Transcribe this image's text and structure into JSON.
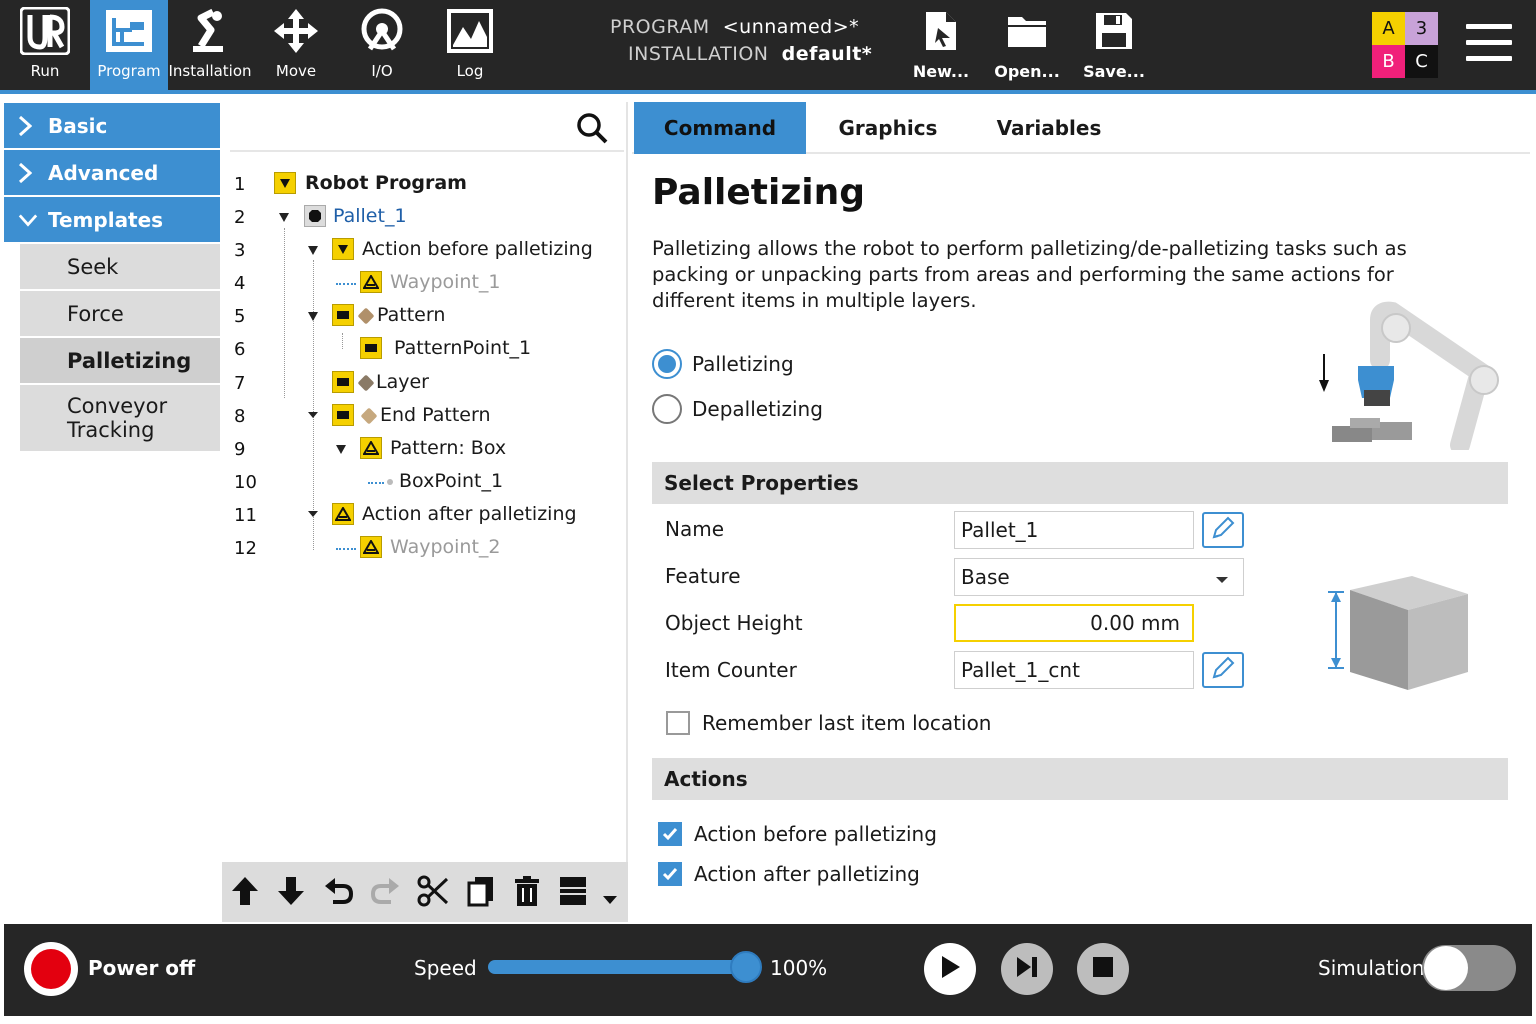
{
  "topbar": {
    "nav": [
      {
        "id": "run",
        "label": "Run",
        "icon": "ur-logo-icon"
      },
      {
        "id": "program",
        "label": "Program",
        "icon": "program-icon"
      },
      {
        "id": "installation",
        "label": "Installation",
        "icon": "installation-icon"
      },
      {
        "id": "move",
        "label": "Move",
        "icon": "move-icon"
      },
      {
        "id": "io",
        "label": "I/O",
        "icon": "io-icon"
      },
      {
        "id": "log",
        "label": "Log",
        "icon": "log-icon"
      }
    ],
    "program_label": "PROGRAM",
    "program_value": "<unnamed>*",
    "installation_label": "INSTALLATION",
    "installation_value": "default*",
    "file_buttons": [
      {
        "id": "new",
        "label": "New..."
      },
      {
        "id": "open",
        "label": "Open..."
      },
      {
        "id": "save",
        "label": "Save..."
      }
    ],
    "abc": {
      "a": "A",
      "three": "3",
      "b": "B",
      "c": "C"
    }
  },
  "sidebar": {
    "categories": [
      {
        "label": "Basic",
        "expanded": false
      },
      {
        "label": "Advanced",
        "expanded": false
      },
      {
        "label": "Templates",
        "expanded": true
      }
    ],
    "templates": [
      "Seek",
      "Force",
      "Palletizing",
      "Conveyor\nTracking"
    ],
    "active_template": "Palletizing"
  },
  "tree": {
    "rows": [
      {
        "num": "1",
        "label": "Robot Program"
      },
      {
        "num": "2",
        "label": "Pallet_1"
      },
      {
        "num": "3",
        "label": "Action before palletizing"
      },
      {
        "num": "4",
        "label": "Waypoint_1"
      },
      {
        "num": "5",
        "label": "Pattern"
      },
      {
        "num": "6",
        "label": "PatternPoint_1"
      },
      {
        "num": "7",
        "label": "Layer"
      },
      {
        "num": "8",
        "label": "End Pattern"
      },
      {
        "num": "9",
        "label": "Pattern: Box"
      },
      {
        "num": "10",
        "label": "BoxPoint_1"
      },
      {
        "num": "11",
        "label": "Action after palletizing"
      },
      {
        "num": "12",
        "label": "Waypoint_2"
      }
    ]
  },
  "tabs": [
    "Command",
    "Graphics",
    "Variables"
  ],
  "main": {
    "title": "Palletizing",
    "description": "Palletizing allows the robot to perform palletizing/de-palletizing tasks such as packing or unpacking parts from areas and performing the same actions for different items in multiple layers.",
    "mode_options": [
      "Palletizing",
      "Depalletizing"
    ],
    "mode_selected": "Palletizing",
    "select_properties_title": "Select Properties",
    "properties": {
      "name_label": "Name",
      "name_value": "Pallet_1",
      "feature_label": "Feature",
      "feature_value": "Base",
      "height_label": "Object Height",
      "height_value": "0.00 mm",
      "counter_label": "Item Counter",
      "counter_value": "Pallet_1_cnt"
    },
    "remember_label": "Remember last item location",
    "remember_checked": false,
    "actions_title": "Actions",
    "action_before_label": "Action before palletizing",
    "action_before_checked": true,
    "action_after_label": "Action after palletizing",
    "action_after_checked": true
  },
  "bottombar": {
    "power_label": "Power off",
    "speed_label": "Speed",
    "speed_value": "100%",
    "speed_fraction": 1.0,
    "simulation_label": "Simulation",
    "simulation_on": false
  },
  "colors": {
    "accent": "#3d8fd1",
    "topbar": "#262626",
    "node_yellow": "#f5d000",
    "power_red": "#e3000f",
    "abc_a": "#f5d000",
    "abc_3": "#c8a2d8",
    "abc_b": "#f0207a",
    "abc_c": "#111111"
  }
}
